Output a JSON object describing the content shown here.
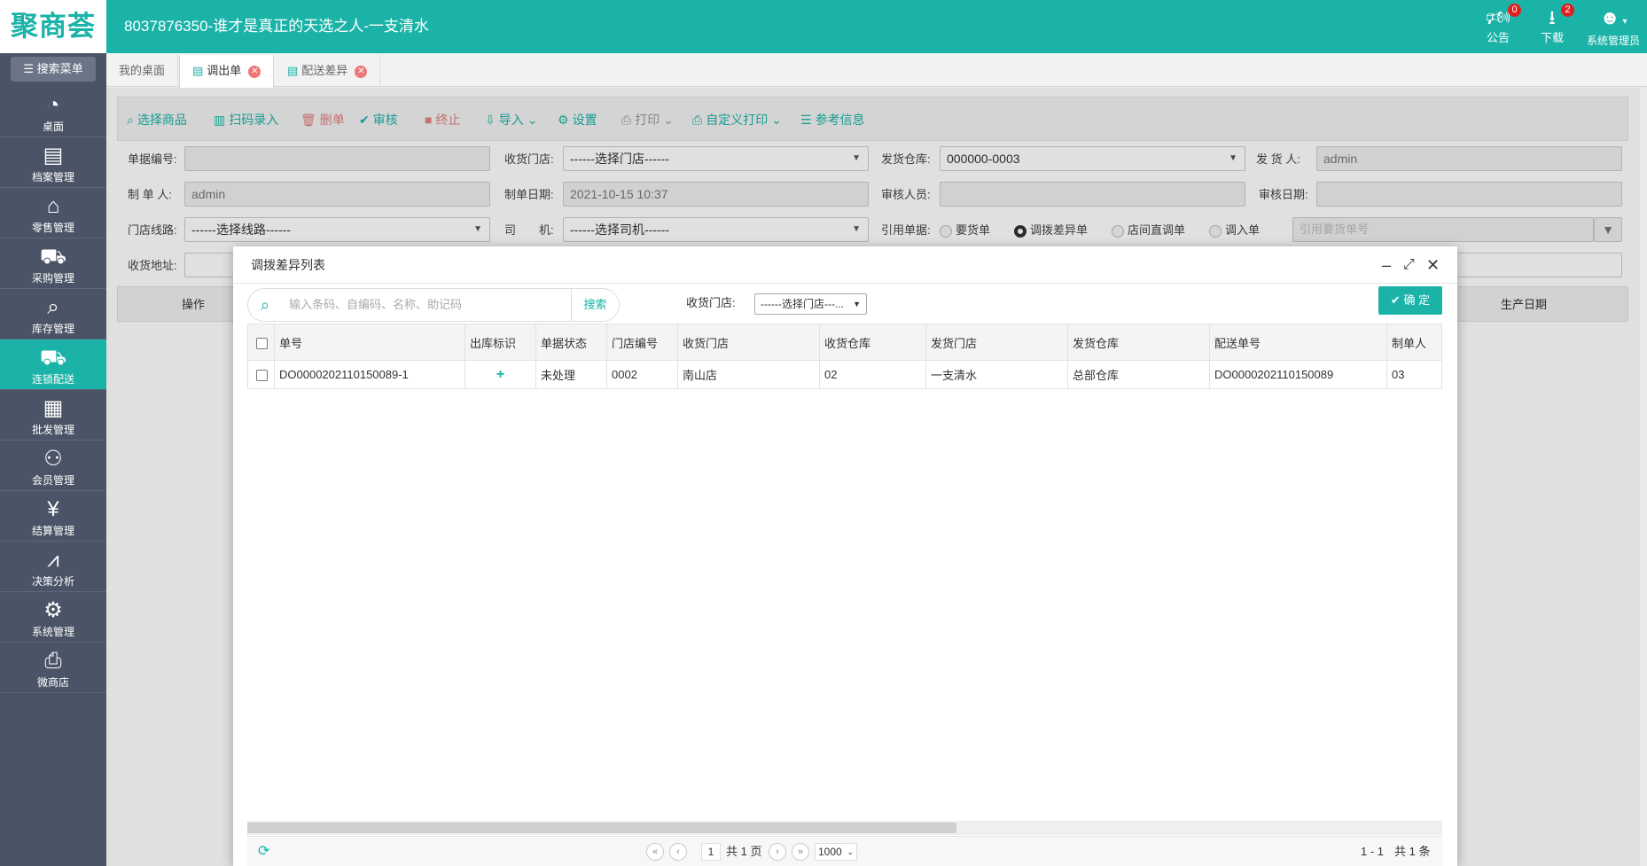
{
  "app": {
    "logo": "聚商荟",
    "title": "8037876350-谁才是真正的天选之人-一支清水"
  },
  "topbar": {
    "announce": {
      "label": "公告",
      "count": "0"
    },
    "download": {
      "label": "下载",
      "count": "2"
    },
    "user": {
      "label": "系统管理员"
    }
  },
  "sidebar": {
    "search_label": "搜索菜单",
    "items": [
      {
        "label": "桌面",
        "icon": "dashboard-icon"
      },
      {
        "label": "档案管理",
        "icon": "archive-icon"
      },
      {
        "label": "零售管理",
        "icon": "store-icon"
      },
      {
        "label": "采购管理",
        "icon": "cart-icon"
      },
      {
        "label": "库存管理",
        "icon": "inventory-search-icon"
      },
      {
        "label": "连锁配送",
        "icon": "truck-icon"
      },
      {
        "label": "批发管理",
        "icon": "wholesale-icon"
      },
      {
        "label": "会员管理",
        "icon": "member-icon"
      },
      {
        "label": "结算管理",
        "icon": "settlement-icon"
      },
      {
        "label": "决策分析",
        "icon": "chart-icon"
      },
      {
        "label": "系统管理",
        "icon": "gear-icon"
      },
      {
        "label": "微商店",
        "icon": "bag-icon"
      }
    ]
  },
  "tabs": [
    {
      "label": "我的桌面"
    },
    {
      "label": "调出单"
    },
    {
      "label": "配送差异"
    }
  ],
  "toolbar": {
    "select_goods": "选择商品",
    "scan": "扫码录入",
    "delete": "删单",
    "audit": "审核",
    "stop": "终止",
    "import": "导入",
    "settings": "设置",
    "print": "打印",
    "custom_print": "自定义打印",
    "reference": "参考信息"
  },
  "form": {
    "doc_no_label": "单据编号:",
    "recv_store_label": "收货门店:",
    "recv_store_value": "------选择门店------",
    "ship_wh_label": "发货仓库:",
    "ship_wh_value": "000000-0003",
    "shipper_label": "发 货 人:",
    "shipper_value": "admin",
    "maker_label": "制 单 人:",
    "maker_value": "admin",
    "make_date_label": "制单日期:",
    "make_date_value": "2021-10-15 10:37",
    "auditor_label": "审核人员:",
    "audit_date_label": "审核日期:",
    "route_label": "门店线路:",
    "route_value": "------选择线路------",
    "driver_label": "司　　机:",
    "driver_value": "------选择司机------",
    "ref_label": "引用单据:",
    "ref_options": [
      "要货单",
      "调拨差异单",
      "店间直调单",
      "调入单"
    ],
    "ref_placeholder": "引用要货单号",
    "address_label": "收货地址:"
  },
  "grid": {
    "op_col": "操作",
    "prod_date_col": "生产日期"
  },
  "modal": {
    "title": "调拨差异列表",
    "search_placeholder": "输入条码、自编码、名称、助记码",
    "search_btn": "搜索",
    "store_label": "收货门店:",
    "store_value": "------选择门店---...",
    "ok": "确 定",
    "columns": [
      "单号",
      "出库标识",
      "单据状态",
      "门店编号",
      "收货门店",
      "收货仓库",
      "发货门店",
      "发货仓库",
      "配送单号",
      "制单人"
    ],
    "rows": [
      {
        "no": "DO0000202110150089-1",
        "flag": "+",
        "status": "未处理",
        "store_no": "0002",
        "recv_store": "南山店",
        "recv_wh": "02",
        "ship_store": "一支清水",
        "ship_wh": "总部仓库",
        "delivery_no": "DO0000202110150089",
        "maker": "03"
      }
    ],
    "pager": {
      "page": "1",
      "total_pages": "共 1 页",
      "page_size": "1000",
      "range": "1 - 1",
      "total": "共 1 条"
    }
  }
}
